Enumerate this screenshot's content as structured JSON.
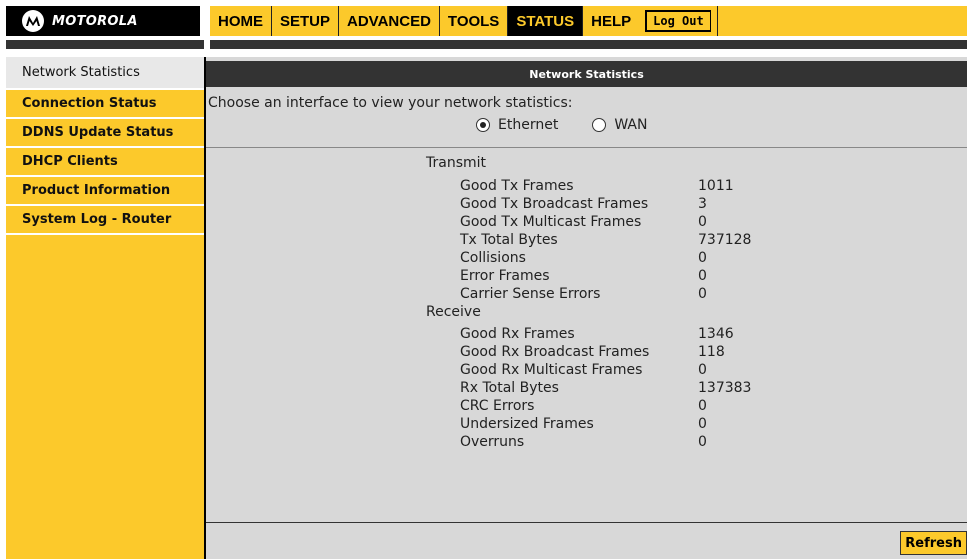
{
  "brand": {
    "logo_text": "MOTOROLA"
  },
  "nav": {
    "items": [
      {
        "label": "HOME"
      },
      {
        "label": "SETUP"
      },
      {
        "label": "ADVANCED"
      },
      {
        "label": "TOOLS"
      },
      {
        "label": "STATUS",
        "active": true
      },
      {
        "label": "HELP"
      }
    ],
    "logout_label": "Log Out"
  },
  "sidebar": {
    "items": [
      {
        "label": "Network Statistics",
        "active": true
      },
      {
        "label": "Connection Status"
      },
      {
        "label": "DDNS Update Status"
      },
      {
        "label": "DHCP Clients"
      },
      {
        "label": "Product Information"
      },
      {
        "label": "System Log - Router"
      }
    ]
  },
  "main": {
    "header": "Network Statistics",
    "prompt": "Choose an interface to view your network statistics:",
    "interfaces": [
      {
        "label": "Ethernet",
        "selected": true
      },
      {
        "label": "WAN",
        "selected": false
      }
    ],
    "transmit": {
      "title": "Transmit",
      "rows": [
        {
          "label": "Good Tx Frames",
          "value": "1011"
        },
        {
          "label": "Good Tx Broadcast Frames",
          "value": "3"
        },
        {
          "label": "Good Tx Multicast Frames",
          "value": "0"
        },
        {
          "label": "Tx Total Bytes",
          "value": "737128"
        },
        {
          "label": "Collisions",
          "value": "0"
        },
        {
          "label": "Error Frames",
          "value": "0"
        },
        {
          "label": "Carrier Sense Errors",
          "value": "0"
        }
      ]
    },
    "receive": {
      "title": "Receive",
      "rows": [
        {
          "label": "Good Rx Frames",
          "value": "1346"
        },
        {
          "label": "Good Rx Broadcast Frames",
          "value": "118"
        },
        {
          "label": "Good Rx Multicast Frames",
          "value": "0"
        },
        {
          "label": "Rx Total Bytes",
          "value": "137383"
        },
        {
          "label": "CRC Errors",
          "value": "0"
        },
        {
          "label": "Undersized Frames",
          "value": "0"
        },
        {
          "label": "Overruns",
          "value": "0"
        }
      ]
    },
    "refresh_label": "Refresh"
  },
  "colors": {
    "accent": "#fcc92b",
    "dark": "#333333",
    "panel": "#d8d8d8"
  }
}
